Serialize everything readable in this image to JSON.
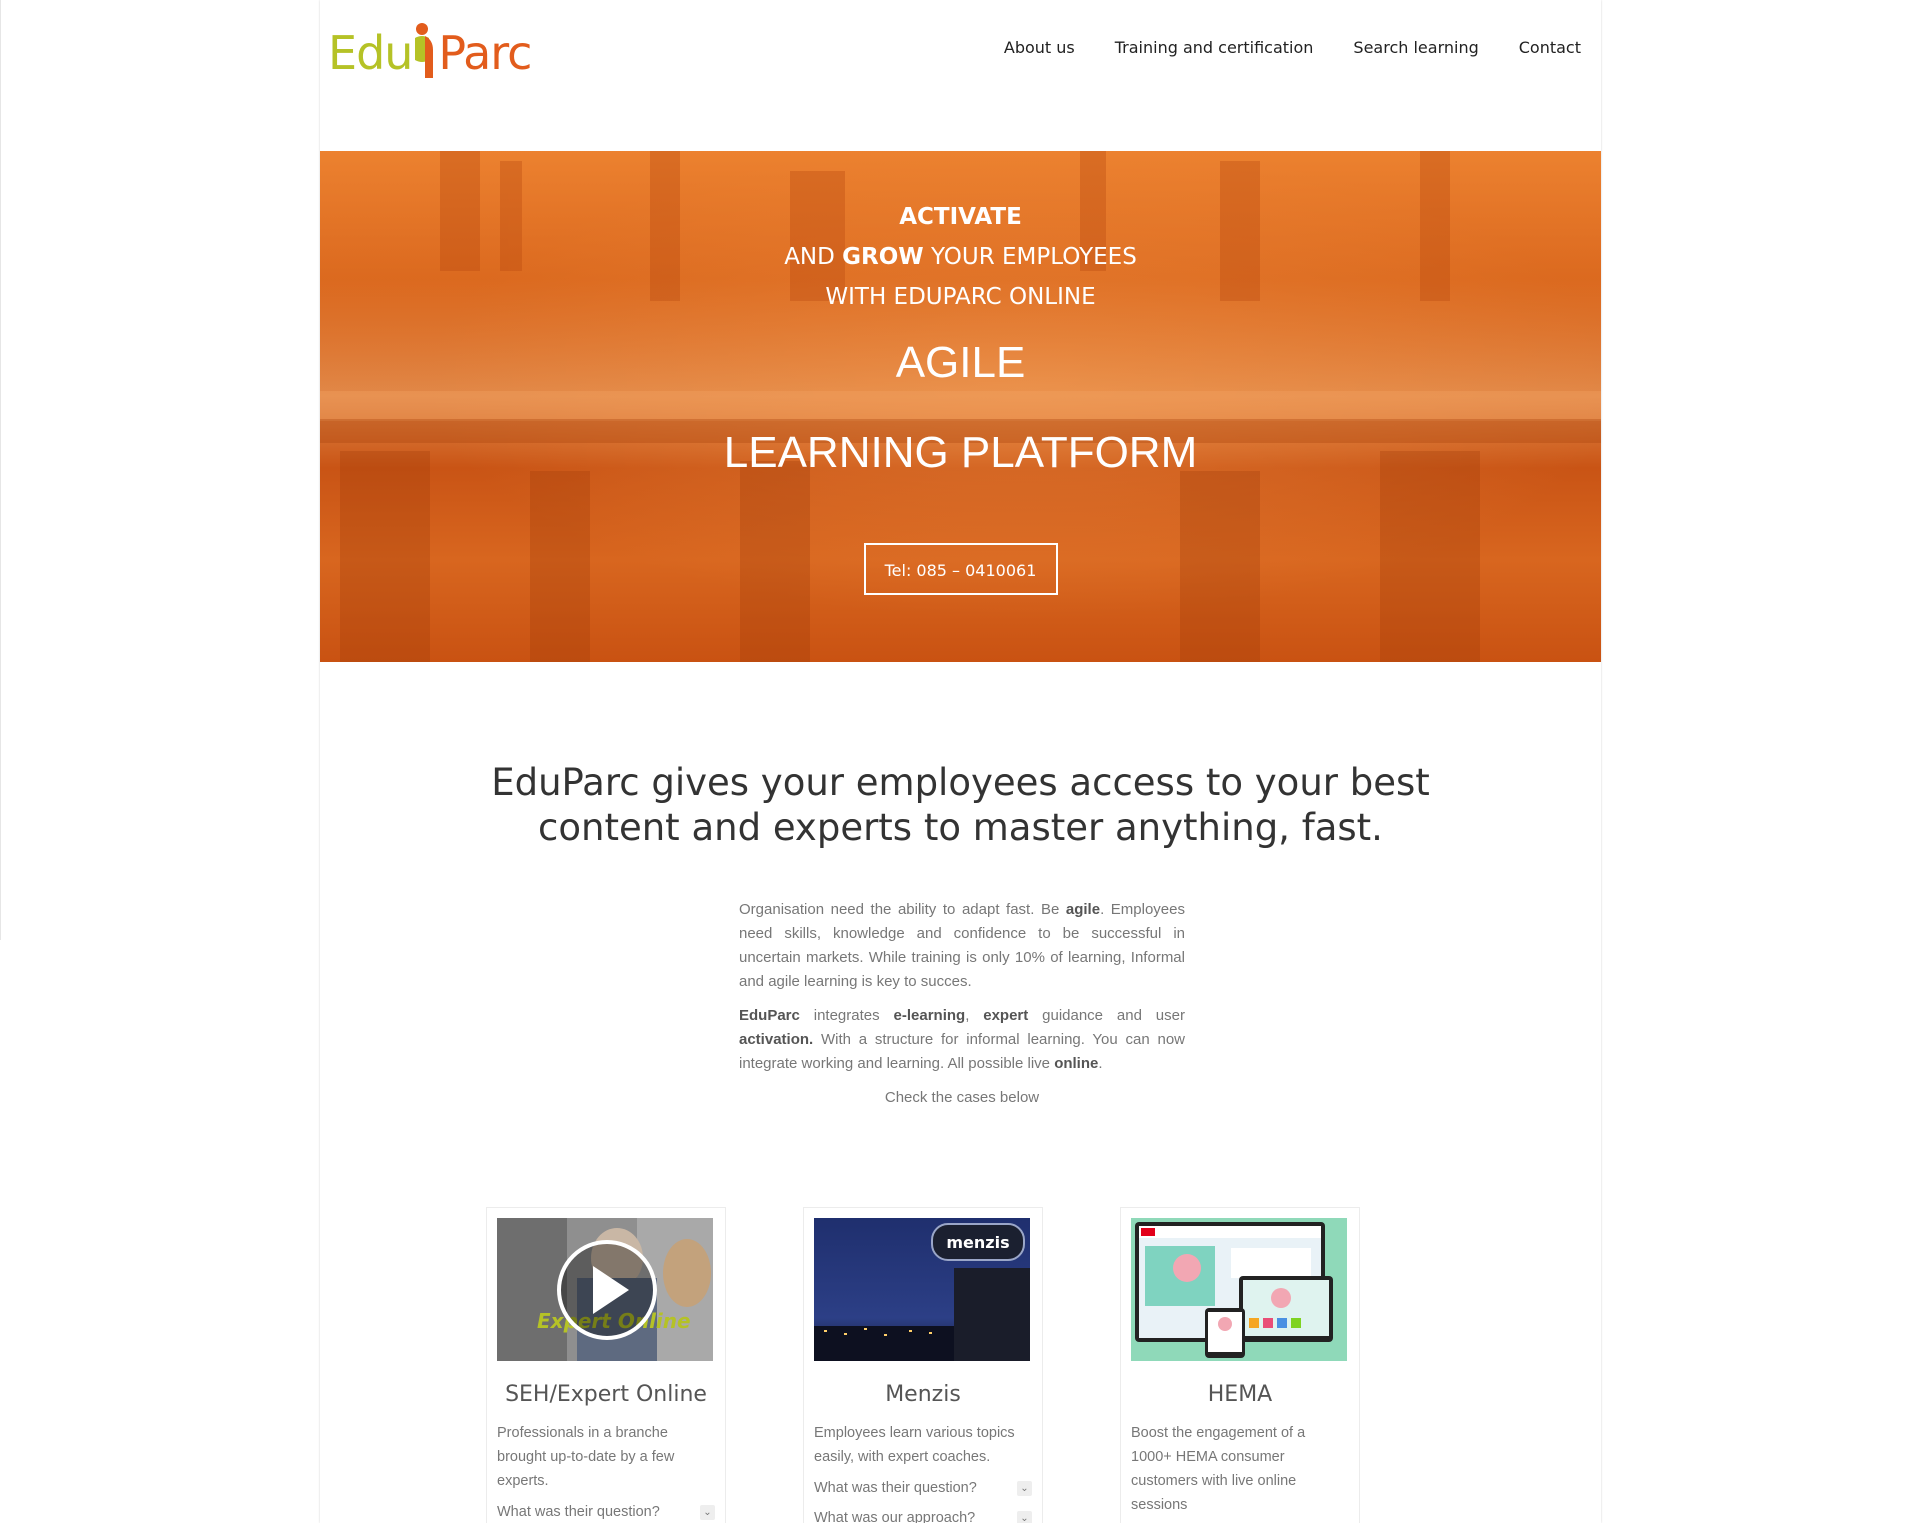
{
  "brand": {
    "logo_left": "Edu",
    "logo_right": "Parc",
    "colors": {
      "green": "#b5c226",
      "orange": "#e25c1c"
    }
  },
  "nav": {
    "items": [
      "About us",
      "Training and certification",
      "Search learning",
      "Contact"
    ]
  },
  "hero": {
    "line1": "ACTIVATE",
    "line2_pre": "AND ",
    "line2_bold": "GROW",
    "line2_post": " YOUR EMPLOYEES",
    "line3": "WITH EDUPARC ONLINE",
    "headline1": "AGILE",
    "headline2": "LEARNING PLATFORM",
    "cta": "Tel: 085 – 0410061",
    "accent": "#d9661c"
  },
  "intro": {
    "title_line1": "EduParc gives your employees access to your best",
    "title_line2": "content and experts to master anything, fast.",
    "p1_a": "Organisation need the ability to adapt fast. Be ",
    "p1_b": "agile",
    "p1_c": ". Employees need skills, knowledge and confidence to be successful in uncertain markets. While training is only 10% of learning, Informal and agile learning is key to succes.",
    "p2_a": "EduParc",
    "p2_b": " integrates ",
    "p2_c": "e-learning",
    "p2_d": ", ",
    "p2_e": "expert",
    "p2_f": " guidance and user ",
    "p2_g": "activation.",
    "p2_h": " With a structure for informal learning. You can now integrate working and learning. All possible live ",
    "p2_i": "online",
    "p2_j": ".",
    "p3": "Check the cases below"
  },
  "cards": [
    {
      "title": "SEH/Expert Online",
      "desc": "Professionals in a branche brought up-to-date by a few experts.",
      "q1": "What was their question?",
      "thumb_icon": "play-icon",
      "thumb_text": "Expert Online"
    },
    {
      "title": "Menzis",
      "desc": "Employees learn various topics easily, with expert coaches.",
      "q1": "What was their question?",
      "q2": "What was our approach?",
      "thumb_text": "menzis"
    },
    {
      "title": "HEMA",
      "desc": "Boost the engagement of a 1000+ HEMA consumer customers with live online sessions"
    }
  ]
}
